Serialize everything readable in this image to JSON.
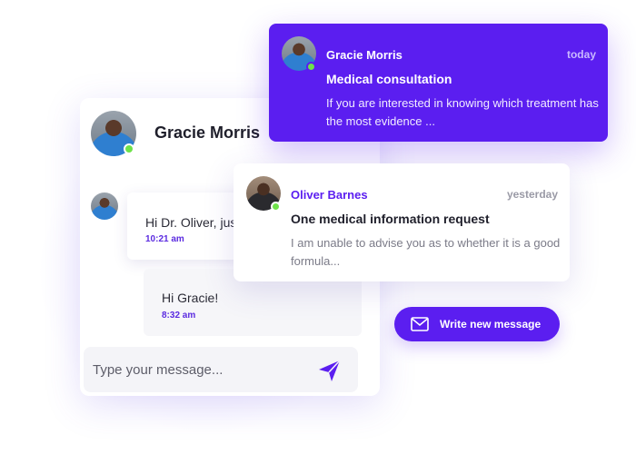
{
  "chat": {
    "contact_name": "Gracie Morris",
    "messages": [
      {
        "text": "Hi Dr. Oliver, just",
        "time": "10:21 am"
      },
      {
        "text": "Hi Gracie!",
        "time": "8:32 am"
      }
    ],
    "composer_placeholder": "Type your message..."
  },
  "notifications": [
    {
      "sender": "Gracie Morris",
      "time": "today",
      "title": "Medical consultation",
      "body": "If you are interested in knowing which treatment has the most evidence ..."
    },
    {
      "sender": "Oliver Barnes",
      "time": "yesterday",
      "title": "One medical information request",
      "body": "I am unable to advise you as to whether it is a good formula..."
    }
  ],
  "write_button": {
    "label": "Write new message",
    "icon": "mail-icon"
  },
  "colors": {
    "accent": "#5b1ef0",
    "online": "#6ee24a",
    "time_accent": "#5b2be0"
  }
}
